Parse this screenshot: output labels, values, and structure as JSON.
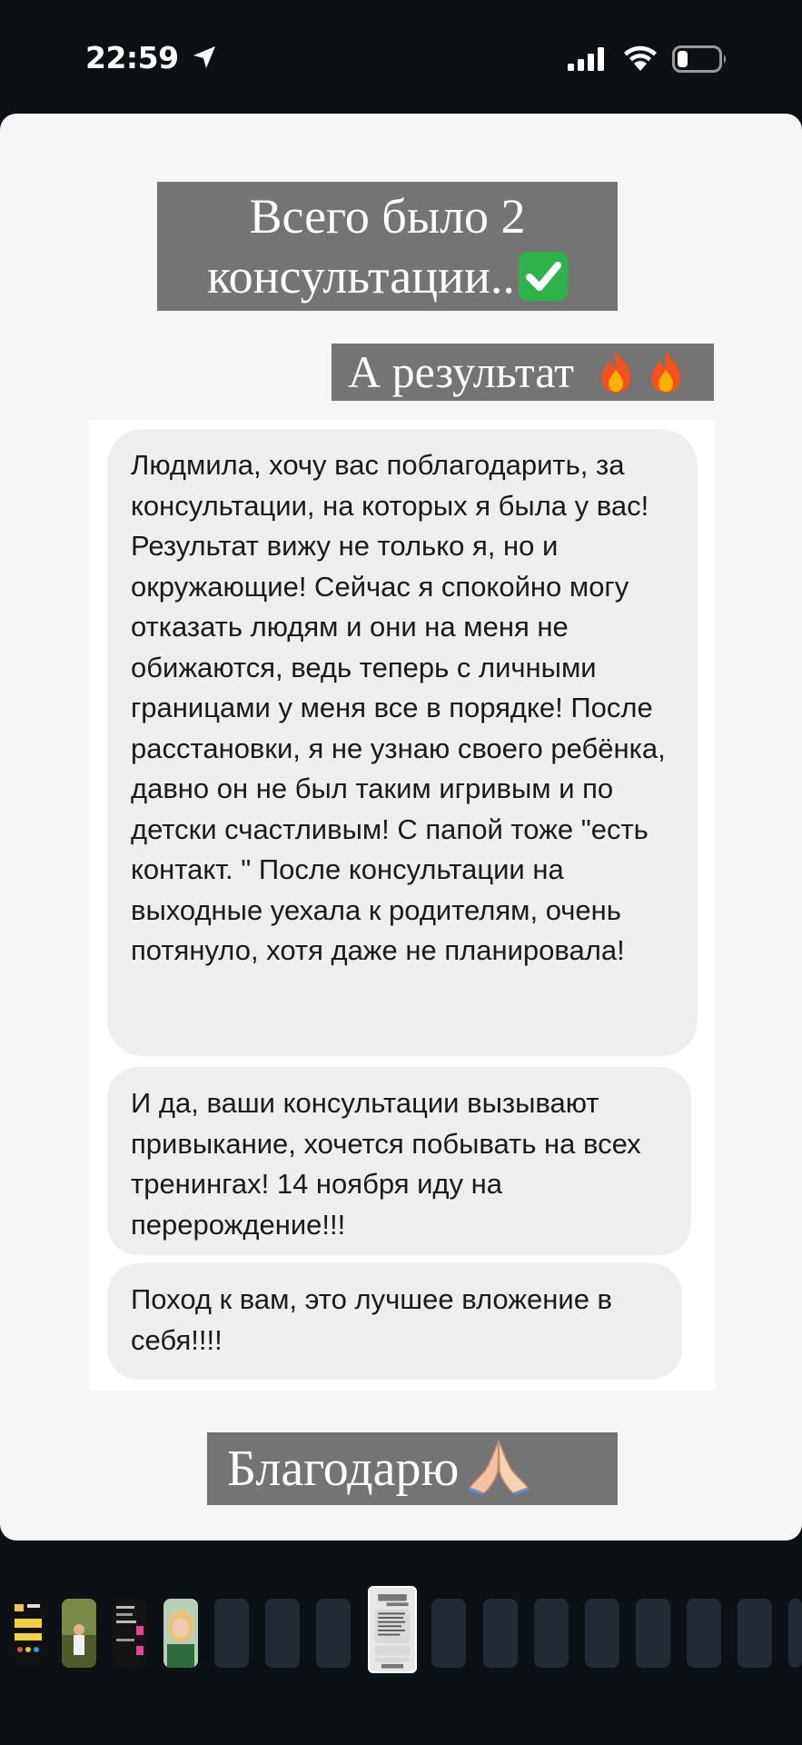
{
  "status_bar": {
    "time": "22:59"
  },
  "story": {
    "title_line1": "Всего было 2",
    "title_line2": "консультации..",
    "result_label": "А результат",
    "messages": [
      "Людмила, хочу вас поблагодарить, за консультации, на которых я была у вас! Результат вижу не только я, но и окружающие! Сейчас я спокойно могу отказать людям и они на меня не обижаются, ведь теперь с личными границами у меня все в порядке! После расстановки, я не узнаю своего ребёнка, давно он не был таким игривым и по детски счастливым! С папой тоже \"есть контакт. \" После консультации на выходные уехала к родителям, очень потянуло, хотя даже не планировала!",
      "И да, ваши консультации вызывают привыкание, хочется побывать на всех тренингах! 14 ноября иду на перерождение!!!",
      "Поход к вам, это лучшее вложение в себя!!!!"
    ],
    "thanks_label": "Благодарю",
    "emojis": [
      "check-mark-emoji",
      "fire-emoji",
      "fire-emoji",
      "folded-hands-emoji"
    ]
  },
  "thumbnails": {
    "count": 16,
    "active_index": 7
  },
  "colors": {
    "background": "#0c1116",
    "card": "#f6f6f6",
    "highlight": "#747474",
    "bubble": "#eeeeee"
  }
}
